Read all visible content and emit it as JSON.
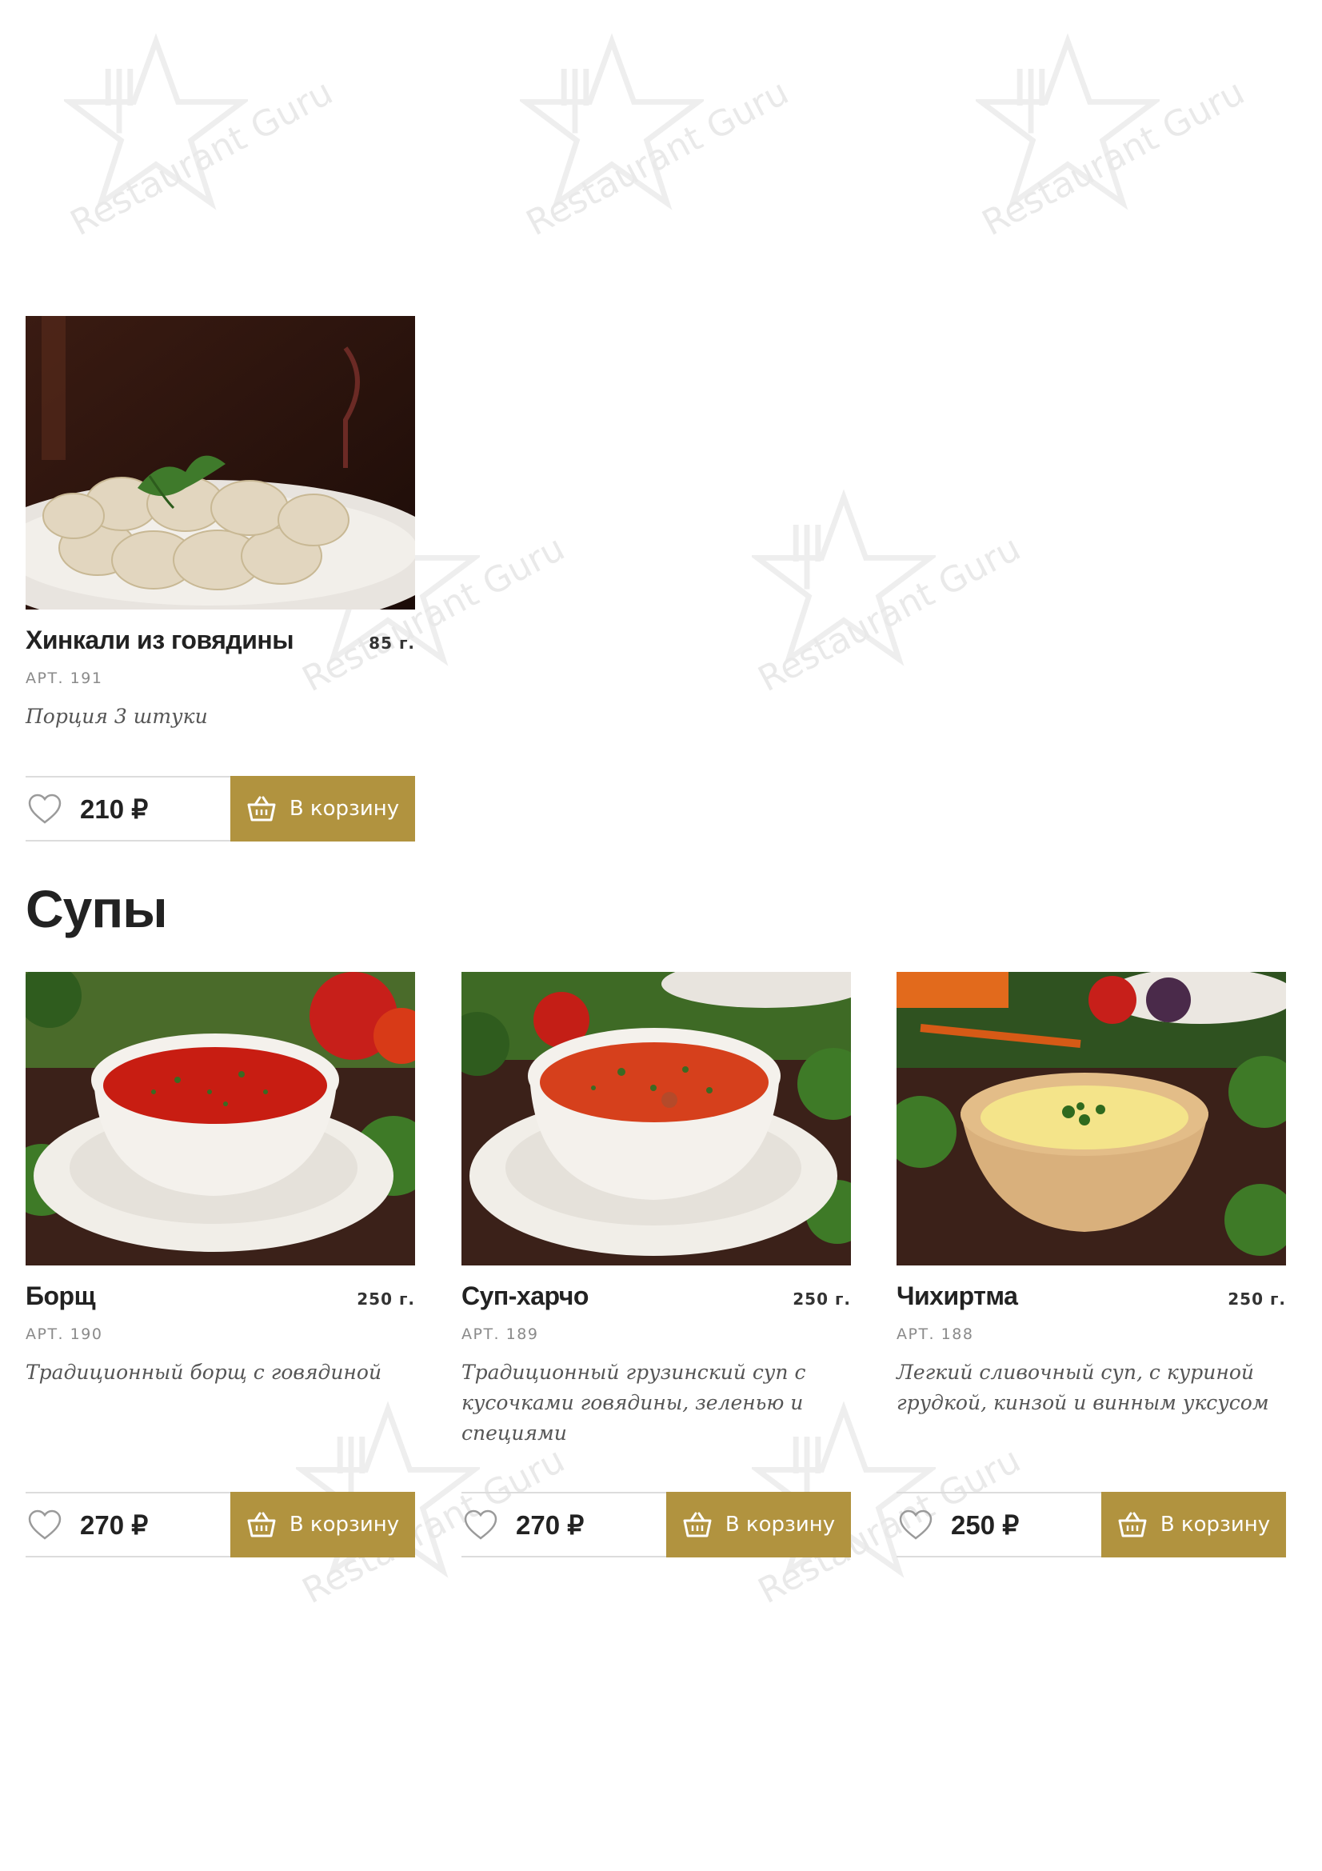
{
  "watermark": {
    "text": "Restaurant Guru",
    "icon": "restaurant-guru-logo-icon"
  },
  "currency": "₽",
  "cart_label": "В корзину",
  "top_product": {
    "name": "Хинкали из говядины",
    "weight": "85 г.",
    "sku": "АРТ. 191",
    "description": "Порция 3 штуки",
    "price": "210",
    "image": "khinkali-dumplings-photo"
  },
  "section": {
    "title": "Супы"
  },
  "soups": [
    {
      "name": "Борщ",
      "weight": "250 г.",
      "sku": "АРТ. 190",
      "description": "Традиционный борщ с говядиной",
      "price": "270",
      "image": "borscht-photo"
    },
    {
      "name": "Суп-харчо",
      "weight": "250 г.",
      "sku": "АРТ. 189",
      "description": "Традиционный грузинский суп с кусочками говядины, зеленью и специями",
      "price": "270",
      "image": "kharcho-soup-photo"
    },
    {
      "name": "Чихиртма",
      "weight": "250 г.",
      "sku": "АРТ. 188",
      "description": "Легкий сливочный суп, с куриной грудкой, кинзой и винным уксусом",
      "price": "250",
      "image": "chikhirtma-soup-photo"
    }
  ],
  "colors": {
    "accent": "#b1933f",
    "text": "#222222",
    "muted": "#8a8a8a",
    "divider": "#dcdcdc"
  }
}
